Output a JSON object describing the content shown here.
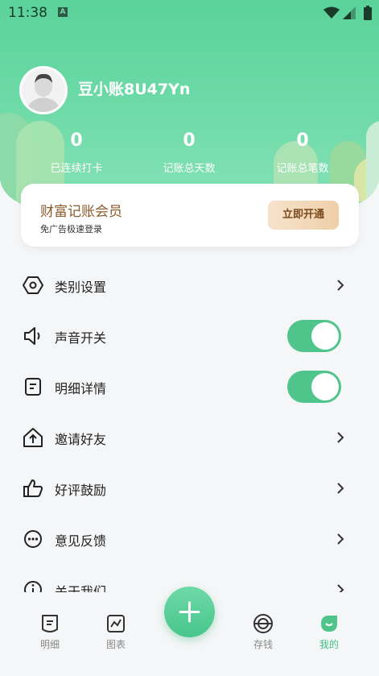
{
  "status_bar": {
    "time": "11:38",
    "notification_icon": "A"
  },
  "profile": {
    "username": "豆小账8U47Yn"
  },
  "stats": [
    {
      "value": "0",
      "label": "已连续打卡"
    },
    {
      "value": "0",
      "label": "记账总天数"
    },
    {
      "value": "0",
      "label": "记账总笔数"
    }
  ],
  "member": {
    "title": "财富记账会员",
    "subtitle": "免广告极速登录",
    "button": "立即开通"
  },
  "menu": [
    {
      "label": "类别设置",
      "icon": "category-icon",
      "control": "chevron"
    },
    {
      "label": "声音开关",
      "icon": "speaker-icon",
      "control": "toggle",
      "on": true
    },
    {
      "label": "明细详情",
      "icon": "detail-icon",
      "control": "toggle",
      "on": true
    },
    {
      "label": "邀请好友",
      "icon": "invite-icon",
      "control": "chevron"
    },
    {
      "label": "好评鼓励",
      "icon": "thumbs-up-icon",
      "control": "chevron"
    },
    {
      "label": "意见反馈",
      "icon": "feedback-icon",
      "control": "chevron"
    },
    {
      "label": "关于我们",
      "icon": "info-icon",
      "control": "chevron"
    }
  ],
  "bottom_nav": {
    "items": [
      {
        "label": "明细",
        "icon": "bill-icon"
      },
      {
        "label": "图表",
        "icon": "chart-icon"
      },
      {
        "label": "存钱",
        "icon": "piggy-icon"
      },
      {
        "label": "我的",
        "icon": "me-icon",
        "active": true
      }
    ]
  },
  "colors": {
    "accent": "#4fc58c",
    "header": "#5bd29a",
    "member_text": "#8a5a2b"
  }
}
